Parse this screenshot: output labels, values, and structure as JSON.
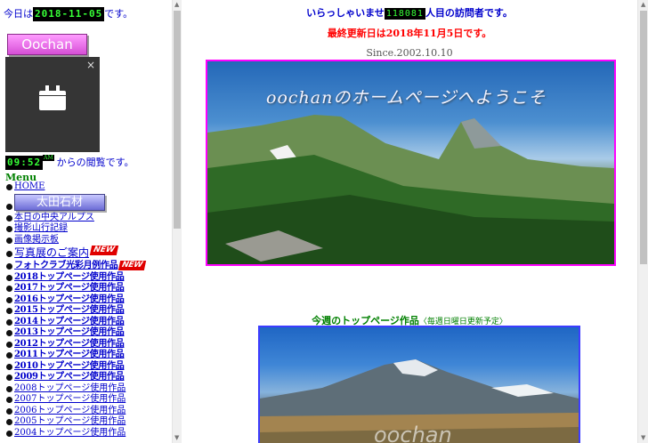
{
  "left": {
    "today_prefix": "今日は",
    "today_date": "2018-11-05",
    "today_suffix": "です。",
    "logo_text": "Oochan",
    "video_close": "×",
    "time_value": "09:52",
    "time_ampm": "AM",
    "time_suffix": "からの閲覧です。",
    "menu_heading": "Menu",
    "menu_items": {
      "home": "HOME",
      "ota": "太田石材",
      "alps": "本日の中央アルプス",
      "trip": "撮影山行記録",
      "bbs": "画像掲示板",
      "exhibit": "写真展のご案内",
      "photoclub": "フォトクラブ光彩月例作品",
      "y2018": "2018トップページ使用作品",
      "y2017": "2017トップページ使用作品",
      "y2016": "2016トップページ使用作品",
      "y2015": "2015トップページ使用作品",
      "y2014": "2014トップページ使用作品",
      "y2013": "2013トップページ使用作品",
      "y2012": "2012トップページ使用作品",
      "y2011": "2011トップページ使用作品",
      "y2010": "2010トップページ使用作品",
      "y2009": "2009トップページ使用作品",
      "y2008": "2008トップページ使用作品",
      "y2007": "2007トップページ使用作品",
      "y2006": "2006トップページ使用作品",
      "y2005": "2005トップページ使用作品",
      "y2004": "2004トップページ使用作品"
    },
    "new_badge": "NEW"
  },
  "right": {
    "welcome_prefix": "いらっしゃいませ",
    "visitor_count": "118081",
    "welcome_suffix": "人目の訪問者です。",
    "updated": "最終更新日は2018年11月5日です。",
    "since": "Since.2002.10.10",
    "banner_title": "oochanのホームページへようこそ",
    "week_title": "今週のトップページ作品",
    "week_note": "〈毎週日曜日更新予定〉",
    "photo_watermark": "oochan"
  },
  "colors": {
    "link": "#0000cc",
    "heading_green": "#008000",
    "update_red": "#ff0000",
    "banner_border": "#ff00ff",
    "photo_border": "#3c3cff"
  }
}
